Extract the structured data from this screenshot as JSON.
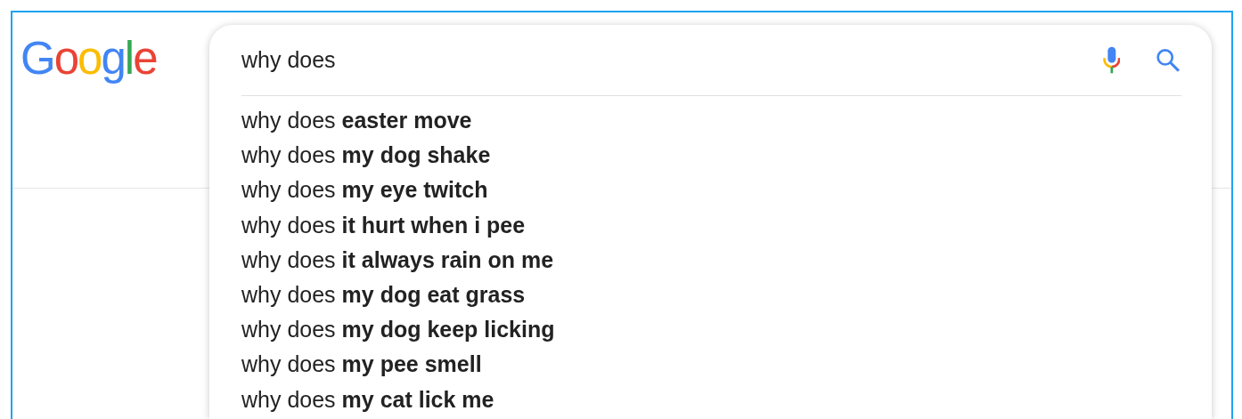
{
  "logo": {
    "letters": [
      {
        "text": "G",
        "color": "#4285f4"
      },
      {
        "text": "o",
        "color": "#ea4335"
      },
      {
        "text": "o",
        "color": "#fbbc05"
      },
      {
        "text": "g",
        "color": "#4285f4"
      },
      {
        "text": "l",
        "color": "#34a853"
      },
      {
        "text": "e",
        "color": "#ea4335"
      }
    ]
  },
  "search": {
    "value": "why does"
  },
  "suggestions": [
    "why does **easter move**",
    "why does **my dog shake**",
    "why does **my eye twitch**",
    "why does **it hurt when i pee**",
    "why does **it always rain on me**",
    "why does **my dog eat grass**",
    "why does **my dog keep licking**",
    "why does **my pee smell**",
    "why does **my cat lick me**"
  ]
}
